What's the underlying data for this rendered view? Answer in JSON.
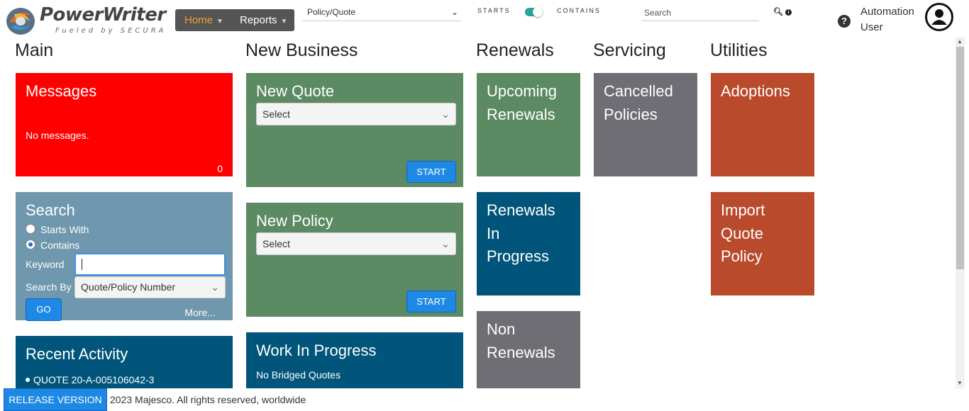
{
  "header": {
    "logo_text": "PowerWriter",
    "logo_sub": "Fueled by SECURA",
    "nav": {
      "home": "Home",
      "reports": "Reports"
    },
    "policy_select": "Policy/Quote",
    "starts_label": "STARTS",
    "contains_label": "CONTAINS",
    "search_placeholder": "Search",
    "help": "?",
    "user_name": "Automation User"
  },
  "sections": {
    "main": "Main",
    "new_business": "New Business",
    "renewals": "Renewals",
    "servicing": "Servicing",
    "utilities": "Utilities"
  },
  "main": {
    "messages": {
      "title": "Messages",
      "text": "No messages.",
      "count": "0"
    },
    "search": {
      "title": "Search",
      "starts_with": "Starts With",
      "contains": "Contains",
      "keyword_label": "Keyword",
      "keyword_value": "",
      "search_by_label": "Search By",
      "search_by_value": "Quote/Policy Number",
      "go": "GO",
      "more": "More..."
    },
    "recent": {
      "title": "Recent Activity",
      "items": [
        "QUOTE 20-A-005106042-3"
      ]
    }
  },
  "new_business": {
    "new_quote": {
      "title": "New Quote",
      "select": "Select",
      "start": "START"
    },
    "new_policy": {
      "title": "New Policy",
      "select": "Select",
      "start": "START"
    },
    "wip": {
      "title": "Work In Progress",
      "text": "No Bridged Quotes"
    }
  },
  "renewals": {
    "upcoming_line1": "Upcoming",
    "upcoming_line2": "Renewals",
    "in_progress_line1": "Renewals",
    "in_progress_line2": "In",
    "in_progress_line3": "Progress",
    "non_line1": "Non",
    "non_line2": "Renewals"
  },
  "servicing": {
    "cancelled_line1": "Cancelled",
    "cancelled_line2": "Policies"
  },
  "utilities": {
    "adoptions": "Adoptions",
    "import_line1": "Import",
    "import_line2": "Quote",
    "import_line3": "Policy"
  },
  "footer": {
    "release": "RELEASE VERSION",
    "copyright": "2023 Majesco. All rights reserved, worldwide"
  },
  "colors": {
    "red": "#ff0000",
    "green": "#5b8a63",
    "steel": "#6f97ad",
    "navy": "#01557a",
    "grey": "#6e6e74",
    "rust": "#b94a2c",
    "button_blue": "#1e88e5",
    "nav_home": "#f0a030"
  }
}
